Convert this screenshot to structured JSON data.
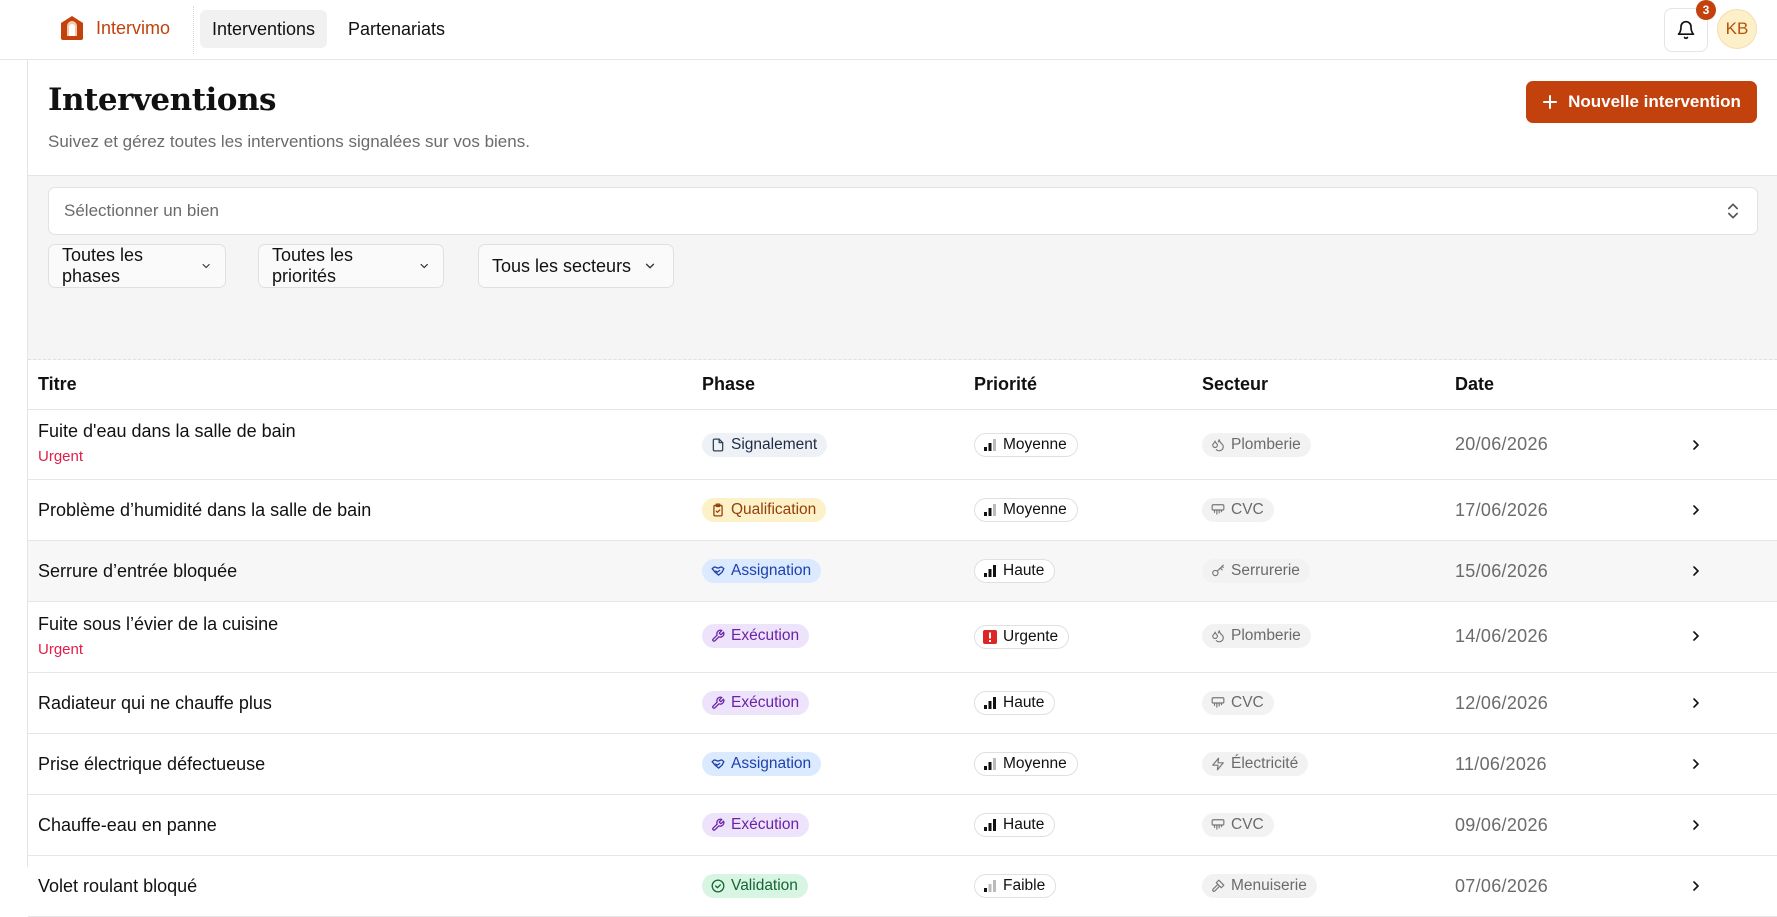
{
  "app": {
    "name": "Intervimo"
  },
  "nav": {
    "tabs": [
      {
        "label": "Interventions",
        "active": true
      },
      {
        "label": "Partenariats",
        "active": false
      }
    ]
  },
  "notifications": {
    "count": "3"
  },
  "user": {
    "initials": "KB"
  },
  "page": {
    "title": "Interventions",
    "subtitle": "Suivez et gérez toutes les interventions signalées sur vos biens.",
    "new_button_label": "Nouvelle intervention"
  },
  "filters": {
    "bien_placeholder": "Sélectionner un bien",
    "phases": "Toutes les phases",
    "priorities": "Toutes les priorités",
    "sectors": "Tous les secteurs"
  },
  "table": {
    "headers": {
      "title": "Titre",
      "phase": "Phase",
      "priority": "Priorité",
      "sector": "Secteur",
      "date": "Date"
    },
    "rows": [
      {
        "title": "Fuite d'eau dans la salle de bain",
        "tag": "Urgent",
        "phase": "Signalement",
        "priority": "Moyenne",
        "sector": "Plomberie",
        "date": "20/06/2026"
      },
      {
        "title": "Problème d’humidité dans la salle de bain",
        "tag": "",
        "phase": "Qualification",
        "priority": "Moyenne",
        "sector": "CVC",
        "date": "17/06/2026"
      },
      {
        "title": "Serrure d’entrée bloquée",
        "tag": "",
        "phase": "Assignation",
        "priority": "Haute",
        "sector": "Serrurerie",
        "date": "15/06/2026"
      },
      {
        "title": "Fuite sous l’évier de la cuisine",
        "tag": "Urgent",
        "phase": "Exécution",
        "priority": "Urgente",
        "sector": "Plomberie",
        "date": "14/06/2026"
      },
      {
        "title": "Radiateur qui ne chauffe plus",
        "tag": "",
        "phase": "Exécution",
        "priority": "Haute",
        "sector": "CVC",
        "date": "12/06/2026"
      },
      {
        "title": "Prise électrique défectueuse",
        "tag": "",
        "phase": "Assignation",
        "priority": "Moyenne",
        "sector": "Électricité",
        "date": "11/06/2026"
      },
      {
        "title": "Chauffe-eau en panne",
        "tag": "",
        "phase": "Exécution",
        "priority": "Haute",
        "sector": "CVC",
        "date": "09/06/2026"
      },
      {
        "title": "Volet roulant bloqué",
        "tag": "",
        "phase": "Validation",
        "priority": "Faible",
        "sector": "Menuiserie",
        "date": "07/06/2026"
      }
    ]
  },
  "colors": {
    "accent": "#c2410c",
    "urgent_text": "#e11d48",
    "phase_signalement": "#eef2f7",
    "phase_qualification": "#fdf1c7",
    "phase_assignation": "#dbeafe",
    "phase_execution": "#ede4fb",
    "phase_validation": "#d8f5e4"
  }
}
